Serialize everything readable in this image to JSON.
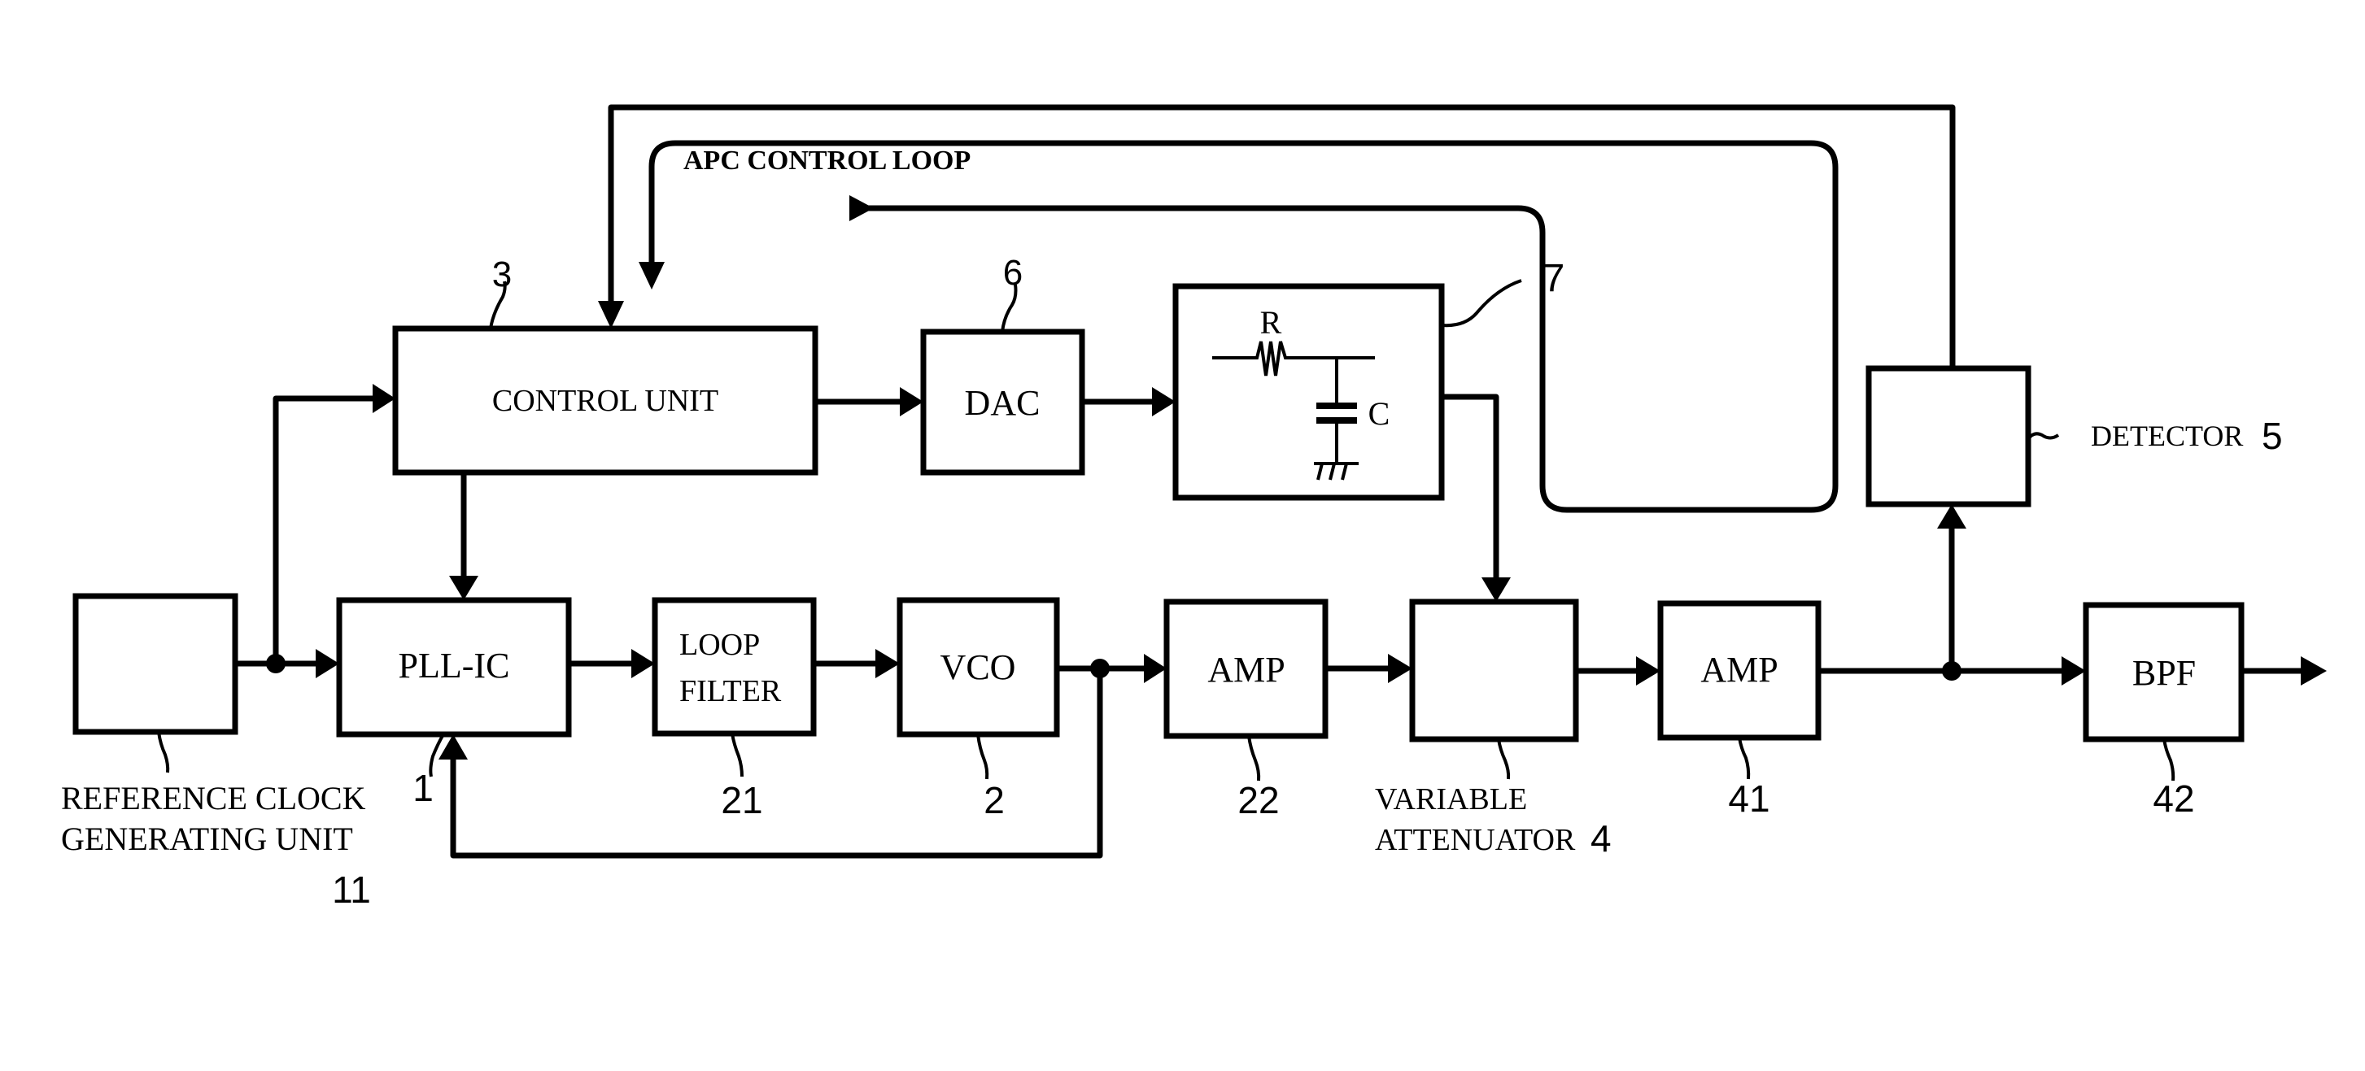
{
  "figure": {
    "loop_label": "APC CONTROL LOOP",
    "blocks": {
      "reference_clock": {
        "label": "REFERENCE CLOCK",
        "label2": "GENERATING UNIT",
        "ref": "11"
      },
      "pll_ic": {
        "label": "PLL-IC",
        "ref": "1"
      },
      "loop_filter": {
        "label": "LOOP",
        "label2": "FILTER",
        "ref": "21"
      },
      "vco": {
        "label": "VCO",
        "ref": "2"
      },
      "amp1": {
        "label": "AMP",
        "ref": "22"
      },
      "variable_attenuator": {
        "label": "VARIABLE",
        "label2": "ATTENUATOR",
        "ref": "4"
      },
      "amp2": {
        "label": "AMP",
        "ref": "41"
      },
      "bpf": {
        "label": "BPF",
        "ref": "42"
      },
      "control_unit": {
        "label": "CONTROL UNIT",
        "ref": "3"
      },
      "dac": {
        "label": "DAC",
        "ref": "6"
      },
      "rc_filter": {
        "r_label": "R",
        "c_label": "C",
        "ref": "7"
      },
      "detector": {
        "label": "DETECTOR",
        "ref": "5"
      }
    }
  }
}
